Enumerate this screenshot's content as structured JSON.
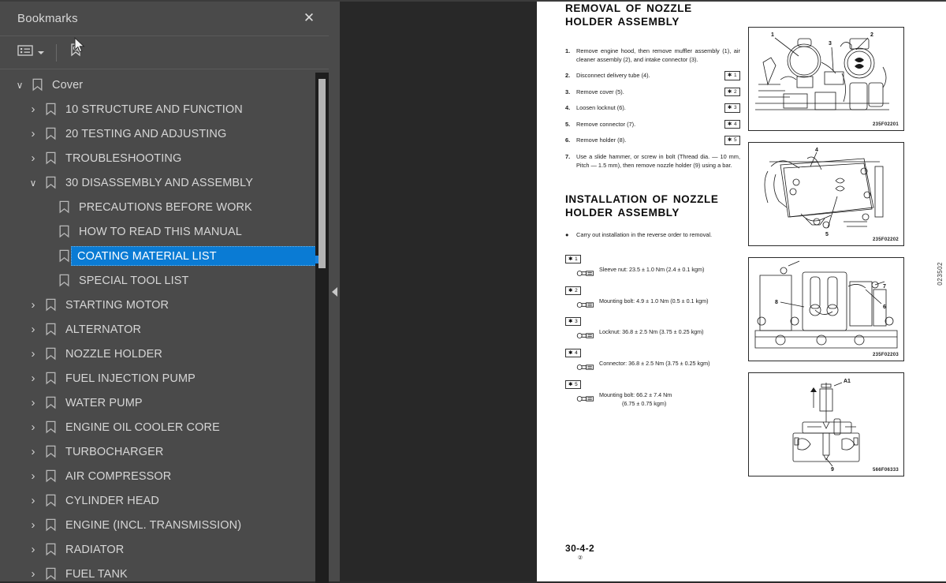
{
  "sidebar": {
    "title": "Bookmarks",
    "close_label": "✕",
    "toolbar": {
      "options_icon": "list-options-icon",
      "find_bookmark_icon": "bookmark-search-icon",
      "dropdown_icon": "chevron-down-icon"
    },
    "tree": [
      {
        "label": "Cover",
        "level": 1,
        "twisty": "expanded",
        "selected": false
      },
      {
        "label": "10 STRUCTURE AND FUNCTION",
        "level": 2,
        "twisty": "collapsed",
        "selected": false
      },
      {
        "label": "20 TESTING AND ADJUSTING",
        "level": 2,
        "twisty": "collapsed",
        "selected": false
      },
      {
        "label": "TROUBLESHOOTING",
        "level": 2,
        "twisty": "collapsed",
        "selected": false
      },
      {
        "label": "30 DISASSEMBLY AND ASSEMBLY",
        "level": 2,
        "twisty": "expanded",
        "selected": false
      },
      {
        "label": "PRECAUTIONS BEFORE WORK",
        "level": 3,
        "twisty": "none",
        "selected": false
      },
      {
        "label": "HOW TO READ THIS MANUAL",
        "level": 3,
        "twisty": "none",
        "selected": false
      },
      {
        "label": "COATING MATERIAL LIST",
        "level": 3,
        "twisty": "none",
        "selected": true
      },
      {
        "label": "SPECIAL TOOL LIST",
        "level": 3,
        "twisty": "none",
        "selected": false
      },
      {
        "label": "STARTING MOTOR",
        "level": 2,
        "twisty": "collapsed",
        "selected": false
      },
      {
        "label": "ALTERNATOR",
        "level": 2,
        "twisty": "collapsed",
        "selected": false
      },
      {
        "label": "NOZZLE HOLDER",
        "level": 2,
        "twisty": "collapsed",
        "selected": false
      },
      {
        "label": "FUEL INJECTION PUMP",
        "level": 2,
        "twisty": "collapsed",
        "selected": false
      },
      {
        "label": "WATER PUMP",
        "level": 2,
        "twisty": "collapsed",
        "selected": false
      },
      {
        "label": "ENGINE OIL COOLER CORE",
        "level": 2,
        "twisty": "collapsed",
        "selected": false
      },
      {
        "label": "TURBOCHARGER",
        "level": 2,
        "twisty": "collapsed",
        "selected": false
      },
      {
        "label": "AIR COMPRESSOR",
        "level": 2,
        "twisty": "collapsed",
        "selected": false
      },
      {
        "label": "CYLINDER HEAD",
        "level": 2,
        "twisty": "collapsed",
        "selected": false
      },
      {
        "label": "ENGINE (INCL. TRANSMISSION)",
        "level": 2,
        "twisty": "collapsed",
        "selected": false
      },
      {
        "label": "RADIATOR",
        "level": 2,
        "twisty": "collapsed",
        "selected": false
      },
      {
        "label": "FUEL TANK",
        "level": 2,
        "twisty": "collapsed",
        "selected": false
      }
    ]
  },
  "splitter": {
    "collapse_icon": "collapse-left-arrow-icon"
  },
  "document": {
    "removal": {
      "heading": "REMOVAL OF NOZZLE HOLDER ASSEMBLY",
      "steps": [
        {
          "num": "1.",
          "text": "Remove engine hood, then remove muffler assembly (1), air cleaner assembly (2), and intake connector (3).",
          "chip": ""
        },
        {
          "num": "2.",
          "text": "Disconnect delivery tube (4).",
          "chip": "✱ 1"
        },
        {
          "num": "3.",
          "text": "Remove cover (5).",
          "chip": "✱ 2"
        },
        {
          "num": "4.",
          "text": "Loosen locknut (6).",
          "chip": "✱ 3"
        },
        {
          "num": "5.",
          "text": "Remove connector (7).",
          "chip": "✱ 4"
        },
        {
          "num": "6.",
          "text": "Remove holder (8).",
          "chip": "✱ 5"
        },
        {
          "num": "7.",
          "text": "Use a slide hammer, or screw in bolt (Thread dia. — 10 mm, Pitch — 1.5 mm), then remove nozzle holder (9) using a bar.",
          "chip": ""
        }
      ]
    },
    "installation": {
      "heading": "INSTALLATION OF NOZZLE HOLDER ASSEMBLY",
      "bullet": "Carry out installation in the reverse order to removal.",
      "torques": [
        {
          "tag": "✱ 1",
          "text": "Sleeve nut:  23.5 ± 1.0 Nm (2.4 ± 0.1 kgm)",
          "text2": ""
        },
        {
          "tag": "✱ 2",
          "text": "Mounting bolt:  4.9 ± 1.0 Nm (0.5 ± 0.1 kgm)",
          "text2": ""
        },
        {
          "tag": "✱ 3",
          "text": "Locknut:  36.8 ± 2.5 Nm (3.75 ± 0.25 kgm)",
          "text2": ""
        },
        {
          "tag": "✱ 4",
          "text": "Connector:  36.8 ± 2.5 Nm (3.75 ± 0.25 kgm)",
          "text2": ""
        },
        {
          "tag": "✱ 5",
          "text": "Mounting bolt:  66.2 ± 7.4 Nm",
          "text2": "(6.75 ± 0.75 kgm)"
        }
      ]
    },
    "figures": [
      {
        "id": "235F02201",
        "callouts": [
          "1",
          "2",
          "3"
        ]
      },
      {
        "id": "235F02202",
        "callouts": [
          "4",
          "5"
        ]
      },
      {
        "id": "235F02203",
        "callouts": [
          "6",
          "7",
          "8"
        ]
      },
      {
        "id": "566F06333",
        "callouts": [
          "A1",
          "9"
        ]
      }
    ],
    "folio": {
      "page_number": "30-4-2",
      "revision": "②"
    },
    "side_code": "023502"
  },
  "colors": {
    "sidebar_bg": "#4a4a4a",
    "viewer_bg": "#282828",
    "selection": "#0a7bd4",
    "page_bg": "#ffffff",
    "text": "#d6d6d6"
  }
}
